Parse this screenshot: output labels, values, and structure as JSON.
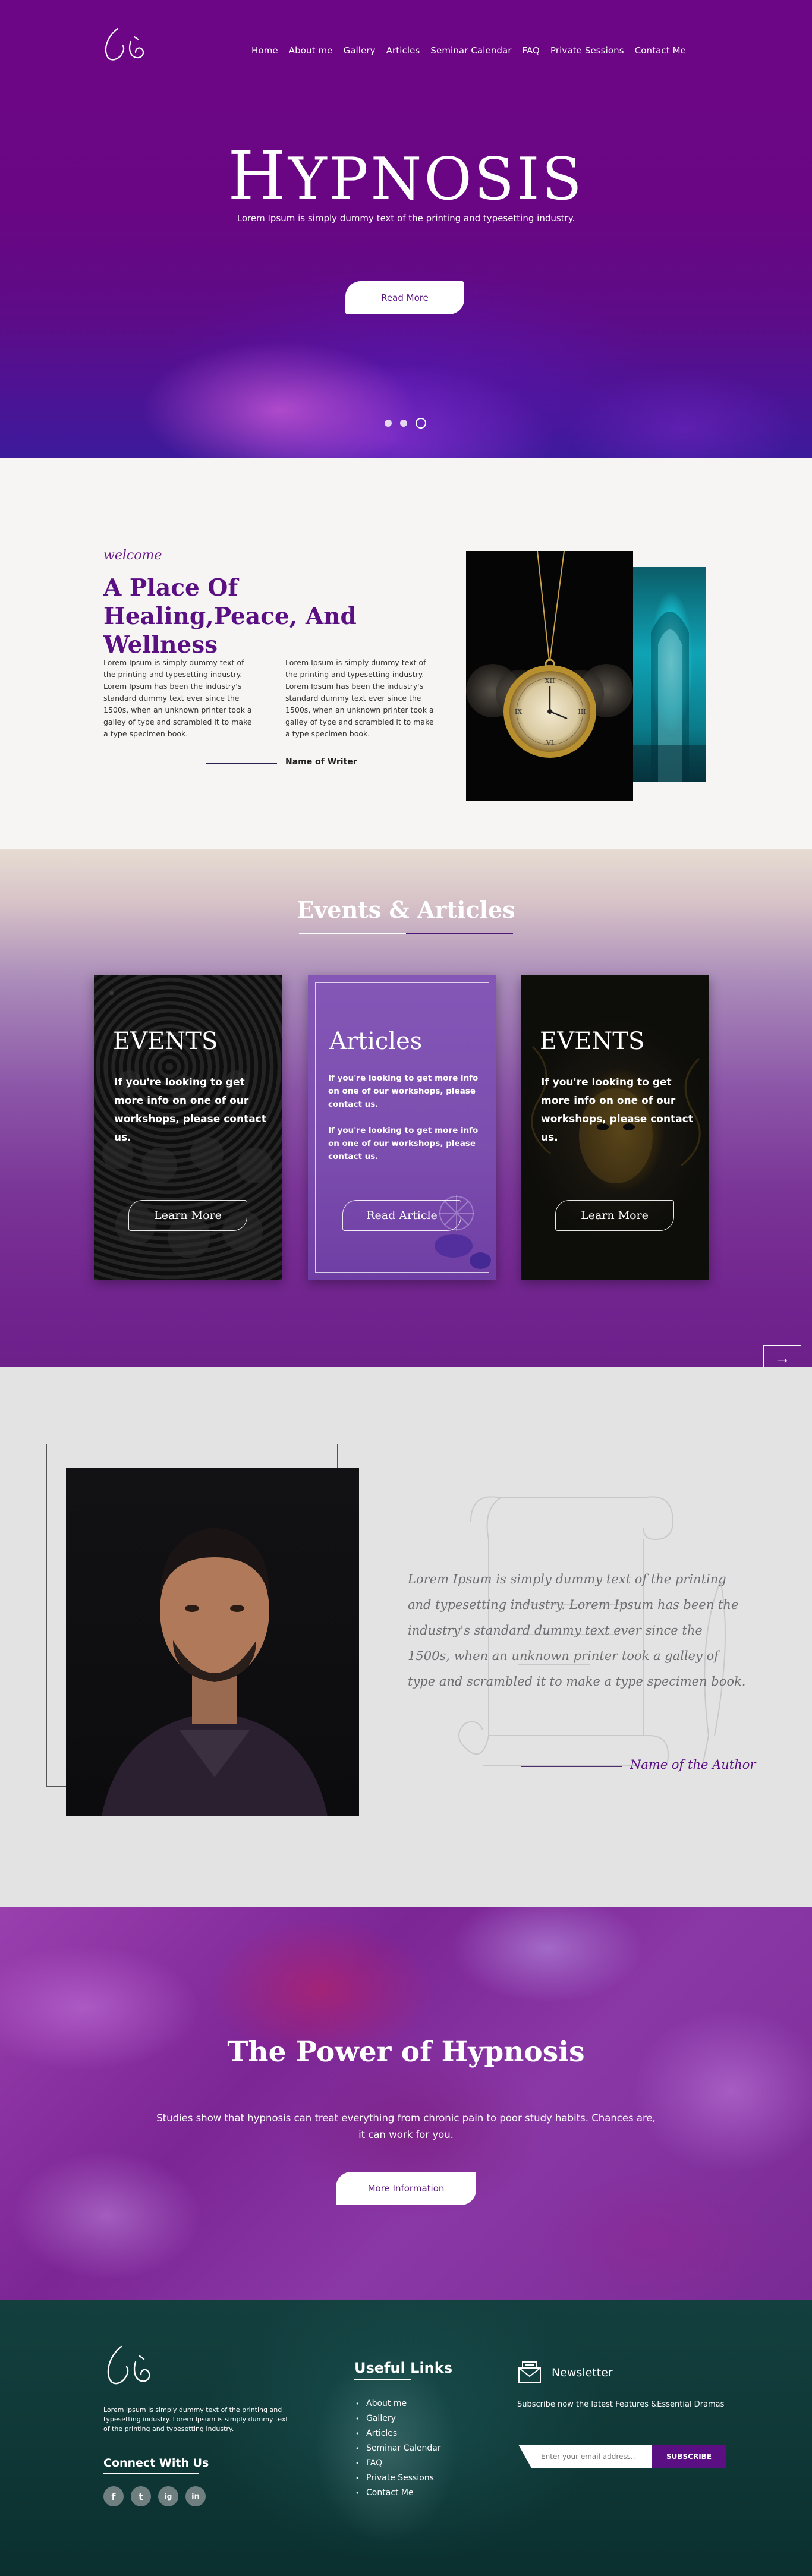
{
  "nav": {
    "items": [
      "Home",
      "About me",
      "Gallery",
      "Articles",
      "Seminar Calendar",
      "FAQ",
      "Private Sessions",
      "Contact Me"
    ]
  },
  "hero": {
    "title_first": "H",
    "title_rest": "YPNOSIS",
    "subtitle": "Lorem Ipsum is simply dummy text of the printing and typesetting industry.",
    "button": "Read More",
    "slides": 3,
    "active_slide": 3
  },
  "welcome": {
    "script": "welcome",
    "title": "A Place Of Healing,Peace, And Wellness",
    "col1": "Lorem Ipsum is simply dummy text of the printing and typesetting industry. Lorem Ipsum has been the industry's standard dummy text ever since the 1500s, when an unknown printer took a galley of type and scrambled it to make a type specimen book.",
    "col2": "Lorem Ipsum is simply dummy text of the printing and typesetting industry. Lorem Ipsum has been the industry's standard dummy text ever since the 1500s, when an unknown printer took a galley of type and scrambled it to make a type specimen book.",
    "writer": "Name of Writer"
  },
  "events": {
    "title": "Events & Articles",
    "cards": [
      {
        "title": "EVENTS",
        "text": "If you're looking to get more info on one of our workshops, please contact us.",
        "button": "Learn More"
      },
      {
        "title": "Articles",
        "text1": "If you're looking to get more info on one of our workshops, please contact us.",
        "text2": "If you're looking to get more info on one of our workshops, please contact us.",
        "button": "Read Article"
      },
      {
        "title": "EVENTS",
        "text": "If you're looking to get more info on one of our workshops, please contact us.",
        "button": "Learn More"
      }
    ],
    "next_icon": "arrow-right-icon",
    "prev_icon": "arrow-left-icon"
  },
  "author": {
    "quote": "Lorem Ipsum is simply dummy text of the printing and typesetting industry. Lorem Ipsum has been the industry's standard dummy text ever since the 1500s, when an unknown printer took a galley of type and scrambled it to make a type specimen book.",
    "name": "Name  of  the  Author"
  },
  "power": {
    "title": "The Power of Hypnosis",
    "text": "Studies show that hypnosis can treat everything from chronic pain to poor study habits. Chances are, it can work for you.",
    "button": "More Information"
  },
  "footer": {
    "about": "Lorem Ipsum is simply dummy text of the printing and typesetting industry. Lorem Ipsum is simply dummy text of the printing and typesetting industry.",
    "connect_title": "Connect With Us",
    "socials": [
      "f",
      "t",
      "ig",
      "in"
    ],
    "links_title": "Useful Links",
    "links": [
      "About me",
      "Gallery",
      "Articles",
      "Seminar Calendar",
      "FAQ",
      "Private Sessions",
      "Contact Me"
    ],
    "newsletter_title": "Newsletter",
    "newsletter_text": "Subscribe now the latest Features &Essential Dramas",
    "email_placeholder": "Enter your email address..",
    "subscribe_button": "SUBSCRIBE"
  },
  "colors": {
    "brand_purple": "#6a0683",
    "accent_purple": "#5a1082",
    "footer_teal": "#13403f"
  }
}
